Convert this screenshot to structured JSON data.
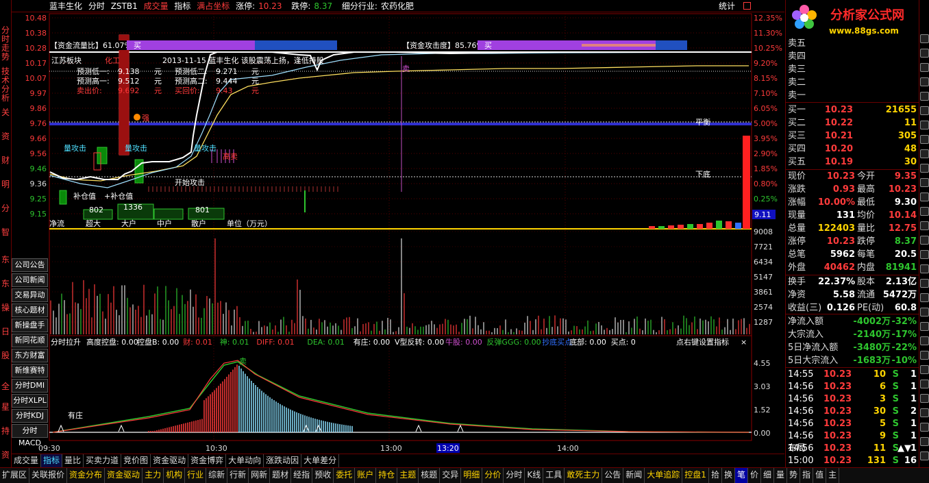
{
  "left_tabs": [
    "分时走势",
    "技术分析",
    "关",
    "资",
    "财",
    "明",
    "分",
    "智",
    "东",
    "东",
    "操",
    "日",
    "股",
    "全",
    "星",
    "持",
    "资"
  ],
  "header": {
    "stock_name": "蓝丰生化",
    "chart_mode": "分时",
    "indicator_code": "ZSTB1",
    "volume_label": "成交量",
    "indicator_label": "指标",
    "coord_label": "满占坐标",
    "limit_up_label": "涨停:",
    "limit_up_value": "10.23",
    "limit_down_label": "跌停:",
    "limit_down_value": "8.37",
    "industry_label": "细分行业:",
    "industry_value": "农药化肥",
    "stat_label": "统计"
  },
  "price_axis": [
    "10.48",
    "10.38",
    "10.28",
    "10.17",
    "10.07",
    "9.97",
    "9.86",
    "9.76",
    "9.66",
    "9.56",
    "9.46",
    "9.36",
    "9.25",
    "9.15"
  ],
  "pct_axis": [
    "12.35%",
    "11.30%",
    "10.25%",
    "9.20%",
    "8.15%",
    "7.10%",
    "6.05%",
    "5.00%",
    "3.95%",
    "2.90%",
    "1.85%",
    "0.80%",
    "0.25%"
  ],
  "price_badge": "9.11",
  "vol_axis": [
    "9008",
    "7721",
    "6434",
    "5147",
    "3861",
    "2574",
    "1287"
  ],
  "macd_axis": [
    "4.55",
    "3.03",
    "1.52",
    "0.00"
  ],
  "time_axis": [
    "09:30",
    "10:30",
    "13:00",
    "13:20",
    "14:00"
  ],
  "overlay": {
    "flow_ratio_label": "【资金流量比】61.07%",
    "flow_ratio_tag": "买",
    "attack_label": "【资金攻击度】85.76%",
    "attack_tag": "买",
    "board": "江苏板块",
    "board_tag": "化工",
    "date_note": "2013-11-15 蓝丰生化 该股震荡上扬，逢低持股",
    "pred_low1_label": "预测低一:",
    "pred_low1": "9.138",
    "pred_low2_label": "预测低二:",
    "pred_low2": "9.271",
    "pred_high1_label": "预测高一:",
    "pred_high1": "9.512",
    "pred_high2_label": "预测高二:",
    "pred_high2": "9.444",
    "sell_label": "卖出价:",
    "sell_price": "9.692",
    "buyback_label": "买回价:",
    "buyback_price": "9.43",
    "unit": "元",
    "attack1": "量攻击",
    "attack2": "量攻击",
    "attack3": "量攻击",
    "strong": "强",
    "sell_mark": "卖",
    "start_attack": "开始攻击",
    "add_pos": "补仓值",
    "add_pos2": "+补仓值",
    "balance": "平衡",
    "bottom": "下底",
    "high_sell": "高卖",
    "fund_labels": [
      "净流",
      "超大",
      "大户",
      "中户",
      "散户"
    ],
    "fund_values": [
      "802",
      "1336",
      "",
      "801"
    ],
    "fund_unit": "单位（万元）"
  },
  "macd_header": {
    "name": "分时拉升",
    "items": [
      {
        "k": "高度控盘:",
        "v": "0.00"
      },
      {
        "k": "控盘B:",
        "v": "0.00"
      },
      {
        "k": "财:",
        "v": "0.01"
      },
      {
        "k": "神:",
        "v": "0.01"
      },
      {
        "k": "DIFF:",
        "v": "0.01"
      },
      {
        "k": "DEA:",
        "v": "0.01"
      },
      {
        "k": "有庄:",
        "v": "0.00"
      },
      {
        "k": "V型反转:",
        "v": "0.00"
      },
      {
        "k": "牛股:",
        "v": "0.00"
      },
      {
        "k": "反弹GGG:",
        "v": "0.00"
      },
      {
        "k": "抄底买点",
        "v": ""
      },
      {
        "k": "底部:",
        "v": "0.00"
      },
      {
        "k": "买点:",
        "v": "0"
      }
    ],
    "hint": "点右键设置指标",
    "youzhuang": "有庄",
    "sell": "卖"
  },
  "side_buttons": [
    "公司公告",
    "公司新闻",
    "交易异动",
    "核心题材",
    "新操盘手",
    "新同花顺",
    "东方财富",
    "新维赛特",
    "分时DMI",
    "分时XLPL",
    "分时KDJ",
    "分时MACD"
  ],
  "quote": {
    "sell_levels": [
      {
        "label": "卖五",
        "price": "",
        "vol": ""
      },
      {
        "label": "卖四",
        "price": "",
        "vol": ""
      },
      {
        "label": "卖三",
        "price": "",
        "vol": ""
      },
      {
        "label": "卖二",
        "price": "",
        "vol": ""
      },
      {
        "label": "卖一",
        "price": "",
        "vol": ""
      }
    ],
    "buy_levels": [
      {
        "label": "买一",
        "price": "10.23",
        "vol": "21655"
      },
      {
        "label": "买二",
        "price": "10.22",
        "vol": "11"
      },
      {
        "label": "买三",
        "price": "10.21",
        "vol": "305"
      },
      {
        "label": "买四",
        "price": "10.20",
        "vol": "48"
      },
      {
        "label": "买五",
        "price": "10.19",
        "vol": "30"
      }
    ],
    "stats": [
      {
        "l1": "现价",
        "v1": "10.23",
        "c1": "red",
        "l2": "今开",
        "v2": "9.35",
        "c2": "red"
      },
      {
        "l1": "涨跌",
        "v1": "0.93",
        "c1": "red",
        "l2": "最高",
        "v2": "10.23",
        "c2": "red"
      },
      {
        "l1": "涨幅",
        "v1": "10.00%",
        "c1": "red",
        "l2": "最低",
        "v2": "9.30",
        "c2": "white"
      },
      {
        "l1": "现量",
        "v1": "131",
        "c1": "white",
        "l2": "均价",
        "v2": "10.14",
        "c2": "red"
      },
      {
        "l1": "总量",
        "v1": "122403",
        "c1": "yellow",
        "l2": "量比",
        "v2": "12.75",
        "c2": "red"
      },
      {
        "l1": "涨停",
        "v1": "10.23",
        "c1": "red",
        "l2": "跌停",
        "v2": "8.37",
        "c2": "green"
      },
      {
        "l1": "总笔",
        "v1": "5962",
        "c1": "white",
        "l2": "每笔",
        "v2": "20.5",
        "c2": "white"
      },
      {
        "l1": "外盘",
        "v1": "40462",
        "c1": "red",
        "l2": "内盘",
        "v2": "81941",
        "c2": "green"
      }
    ],
    "stats2": [
      {
        "l1": "换手",
        "v1": "22.37%",
        "c1": "white",
        "l2": "股本",
        "v2": "2.13亿",
        "c2": "white"
      },
      {
        "l1": "净资",
        "v1": "5.58",
        "c1": "white",
        "l2": "流通",
        "v2": "5472万",
        "c2": "white"
      },
      {
        "l1": "收益(三)",
        "v1": "0.126",
        "c1": "white",
        "l2": "PE(动)",
        "v2": "60.8",
        "c2": "white"
      }
    ],
    "flows": [
      {
        "label": "净流入额",
        "value": "-4002万",
        "pct": "-32%"
      },
      {
        "label": "大宗流入",
        "value": "-2140万",
        "pct": "-17%"
      },
      {
        "label": "5日净流入额",
        "value": "-3480万",
        "pct": "-22%"
      },
      {
        "label": "5日大宗流入",
        "value": "-1683万",
        "pct": "-10%"
      }
    ],
    "ticks": [
      {
        "t": "14:55",
        "p": "10.23",
        "v": "10",
        "s": "S",
        "n": "1"
      },
      {
        "t": "14:56",
        "p": "10.23",
        "v": "6",
        "s": "S",
        "n": "1"
      },
      {
        "t": "14:56",
        "p": "10.23",
        "v": "3",
        "s": "S",
        "n": "1"
      },
      {
        "t": "14:56",
        "p": "10.23",
        "v": "30",
        "s": "S",
        "n": "2"
      },
      {
        "t": "14:56",
        "p": "10.23",
        "v": "5",
        "s": "S",
        "n": "1"
      },
      {
        "t": "14:56",
        "p": "10.23",
        "v": "9",
        "s": "S",
        "n": "1"
      },
      {
        "t": "14:56",
        "p": "10.23",
        "v": "11",
        "s": "S",
        "n": "1"
      },
      {
        "t": "15:00",
        "p": "10.23",
        "v": "131",
        "s": "S",
        "n": "16"
      }
    ],
    "layout_label": "布局",
    "layout_dir": "▲▼"
  },
  "logo": {
    "title": "分析家公式网",
    "url": "www.88gs.com"
  },
  "tabs1": [
    "成交量",
    "指标",
    "量比",
    "买卖力道",
    "竞价图",
    "资金驱动",
    "资金博弈",
    "大单动向",
    "涨跌动因",
    "大单差分"
  ],
  "tabs1_active": 1,
  "tabs2": [
    "扩展区",
    "关联报价",
    "资金分布",
    "资金驱动",
    "主力",
    "机构",
    "行业",
    "综新",
    "行新",
    "网新",
    "题材",
    "经指",
    "预收",
    "委托",
    "账户",
    "持仓",
    "主题",
    "核题",
    "交异",
    "明细",
    "分价",
    "分时",
    "K线",
    "工具",
    "敢死主力",
    "公告",
    "新闻",
    "大单追踪",
    "控盘1",
    "拾",
    "换",
    "笔",
    "价",
    "细",
    "量",
    "势",
    "指",
    "值",
    "主"
  ],
  "tabs2_hl": [
    2,
    3,
    4,
    5,
    6,
    13,
    14,
    15,
    16,
    19,
    20,
    24,
    27,
    28
  ],
  "tabs2_sel": [
    31
  ],
  "chart_data": {
    "type": "line",
    "x_range": [
      "09:30",
      "15:00"
    ],
    "ylim": [
      9.11,
      10.48
    ],
    "series": [],
    "limit_up": 10.23,
    "prev_close": 9.3
  }
}
